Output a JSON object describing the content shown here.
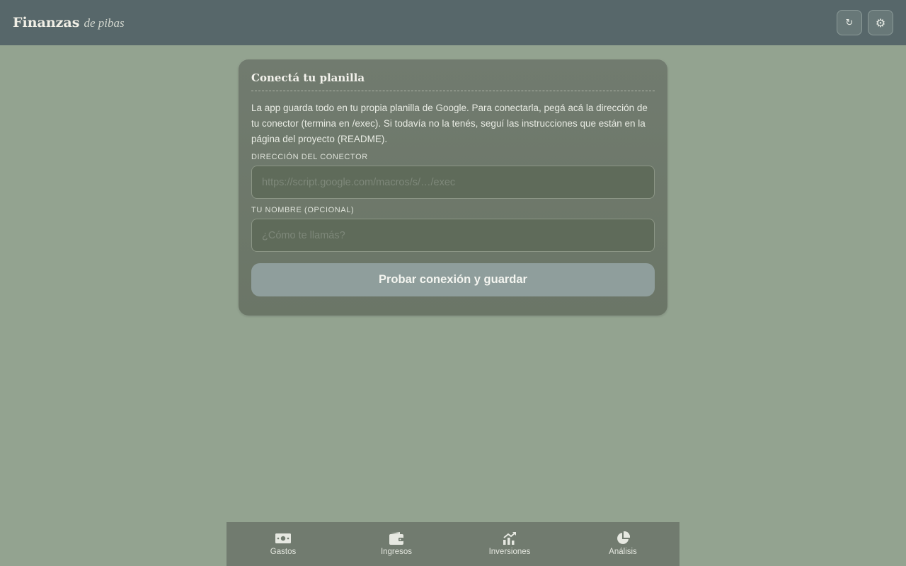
{
  "header": {
    "brand_main": "Finanzas",
    "brand_sub": "de pibas",
    "refresh_icon": "↻",
    "settings_icon": "⚙"
  },
  "setup": {
    "title": "Conectá tu planilla",
    "description": "La app guarda todo en tu propia planilla de Google. Para conectarla, pegá acá la dirección de tu conector (termina en /exec). Si todavía no la tenés, seguí las instrucciones que están en la página del proyecto (README).",
    "connector_label": "Dirección del conector",
    "connector_placeholder": "https://script.google.com/macros/s/…/exec",
    "connector_value": "",
    "name_label": "Tu nombre (opcional)",
    "name_placeholder": "¿Cómo te llamás?",
    "name_value": "",
    "submit_label": "Probar conexión y guardar"
  },
  "nav": {
    "items": [
      {
        "label": "Gastos",
        "icon": "cash-icon"
      },
      {
        "label": "Ingresos",
        "icon": "wallet-icon"
      },
      {
        "label": "Inversiones",
        "icon": "growth-chart-icon"
      },
      {
        "label": "Análisis",
        "icon": "pie-chart-icon"
      }
    ]
  },
  "colors": {
    "background": "#93a390",
    "topbar": "#57676a",
    "card": "#717b6f",
    "button": "#8f9e9c"
  }
}
